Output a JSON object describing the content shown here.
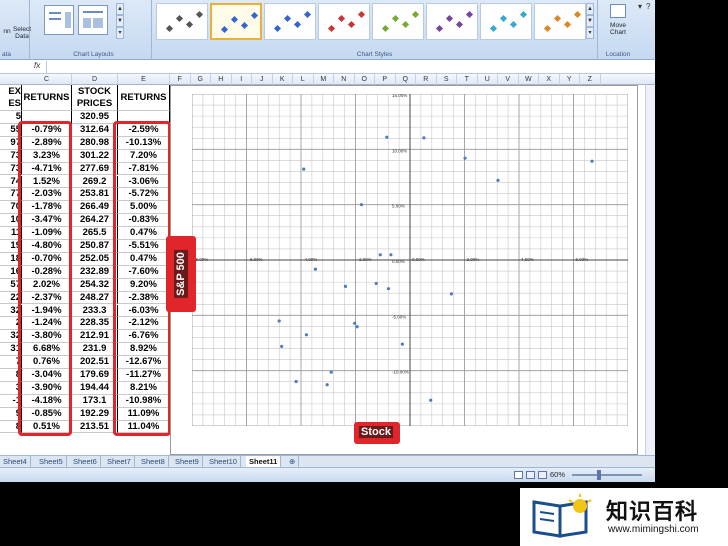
{
  "ribbon": {
    "left_group_partial": "ata",
    "small_btn_partial": "nn",
    "select_data": "Select Data",
    "chart_layouts_label": "Chart Layouts",
    "chart_styles_label": "Chart Styles",
    "move_chart": "Move Chart",
    "location_label": "Location",
    "style_colors": [
      "#555555",
      "#3366cc",
      "#3366cc",
      "#cc3333",
      "#77aa33",
      "#774499",
      "#33aacc",
      "#dd8822"
    ]
  },
  "formula_bar": {
    "fx_label": "fx"
  },
  "columns": [
    "C",
    "D",
    "E",
    "F",
    "G",
    "H",
    "I",
    "J",
    "K",
    "L",
    "M",
    "N",
    "O",
    "P",
    "Q",
    "R",
    "S",
    "T",
    "U",
    "V",
    "W",
    "X",
    "Y",
    "Z"
  ],
  "table": {
    "headers": {
      "b_line1": "EX",
      "b_line2": "ES",
      "c": "RETURNS",
      "d_line1": "STOCK",
      "d_line2": "PRICES",
      "e": "RETURNS"
    },
    "first_row": {
      "b": "5",
      "d": "320.95"
    },
    "rows": [
      {
        "b": "55",
        "c": "-0.79%",
        "d": "312.64",
        "e": "-2.59%"
      },
      {
        "b": "97",
        "c": "-2.89%",
        "d": "280.98",
        "e": "-10.13%"
      },
      {
        "b": "73",
        "c": "3.23%",
        "d": "301.22",
        "e": "7.20%"
      },
      {
        "b": "73",
        "c": "-4.71%",
        "d": "277.69",
        "e": "-7.81%"
      },
      {
        "b": "74",
        "c": "1.52%",
        "d": "269.2",
        "e": "-3.06%"
      },
      {
        "b": "77",
        "c": "-2.03%",
        "d": "253.81",
        "e": "-5.72%"
      },
      {
        "b": "70",
        "c": "-1.78%",
        "d": "266.49",
        "e": "5.00%"
      },
      {
        "b": "10",
        "c": "-3.47%",
        "d": "264.27",
        "e": "-0.83%"
      },
      {
        "b": "11",
        "c": "-1.09%",
        "d": "265.5",
        "e": "0.47%"
      },
      {
        "b": "19",
        "c": "-4.80%",
        "d": "250.87",
        "e": "-5.51%"
      },
      {
        "b": "18",
        "c": "-0.70%",
        "d": "252.05",
        "e": "0.47%"
      },
      {
        "b": "16",
        "c": "-0.28%",
        "d": "232.89",
        "e": "-7.60%"
      },
      {
        "b": "57",
        "c": "2.02%",
        "d": "254.32",
        "e": "9.20%"
      },
      {
        "b": "22",
        "c": "-2.37%",
        "d": "248.27",
        "e": "-2.38%"
      },
      {
        "b": "32",
        "c": "-1.94%",
        "d": "233.3",
        "e": "-6.03%"
      },
      {
        "b": "2",
        "c": "-1.24%",
        "d": "228.35",
        "e": "-2.12%"
      },
      {
        "b": "32",
        "c": "-3.80%",
        "d": "212.91",
        "e": "-6.76%"
      },
      {
        "b": "31",
        "c": "6.68%",
        "d": "231.9",
        "e": "8.92%"
      },
      {
        "b": "7",
        "c": "0.76%",
        "d": "202.51",
        "e": "-12.67%"
      },
      {
        "b": "8",
        "c": "-3.04%",
        "d": "179.69",
        "e": "-11.27%"
      },
      {
        "b": "3",
        "c": "-3.90%",
        "d": "194.44",
        "e": "8.21%"
      },
      {
        "b": "-1",
        "c": "-4.18%",
        "d": "173.1",
        "e": "-10.98%"
      },
      {
        "b": "9",
        "c": "-0.85%",
        "d": "192.29",
        "e": "11.09%"
      },
      {
        "b": "8",
        "c": "0.51%",
        "d": "213.51",
        "e": "11.04%"
      }
    ]
  },
  "callouts": {
    "sp500": "S&P 500",
    "stock": "Stock"
  },
  "chart_data": {
    "type": "scatter",
    "x_ticks": [
      "-8.00%",
      "-6.00%",
      "-4.00%",
      "-2.00%",
      "0.00%",
      "2.00%",
      "4.00%",
      "6.00%",
      "8.00%"
    ],
    "y_ticks": [
      "15.00%",
      "10.00%",
      "5.00%",
      "0.00%",
      "-5.00%",
      "-10.00%",
      "-15.00%"
    ],
    "xlim": [
      -8,
      8
    ],
    "ylim": [
      -15,
      15
    ],
    "grid": true,
    "point_color": "#4a7ebb",
    "points": [
      {
        "x": -0.79,
        "y": -2.59
      },
      {
        "x": -2.89,
        "y": -10.13
      },
      {
        "x": 3.23,
        "y": 7.2
      },
      {
        "x": -4.71,
        "y": -7.81
      },
      {
        "x": 1.52,
        "y": -3.06
      },
      {
        "x": -2.03,
        "y": -5.72
      },
      {
        "x": -1.78,
        "y": 5.0
      },
      {
        "x": -3.47,
        "y": -0.83
      },
      {
        "x": -1.09,
        "y": 0.47
      },
      {
        "x": -4.8,
        "y": -5.51
      },
      {
        "x": -0.7,
        "y": 0.47
      },
      {
        "x": -0.28,
        "y": -7.6
      },
      {
        "x": 2.02,
        "y": 9.2
      },
      {
        "x": -2.37,
        "y": -2.38
      },
      {
        "x": -1.94,
        "y": -6.03
      },
      {
        "x": -1.24,
        "y": -2.12
      },
      {
        "x": -3.8,
        "y": -6.76
      },
      {
        "x": 6.68,
        "y": 8.92
      },
      {
        "x": 0.76,
        "y": -12.67
      },
      {
        "x": -3.04,
        "y": -11.27
      },
      {
        "x": -3.9,
        "y": 8.21
      },
      {
        "x": -4.18,
        "y": -10.98
      },
      {
        "x": -0.85,
        "y": 11.09
      },
      {
        "x": 0.51,
        "y": 11.04
      }
    ]
  },
  "sheet_tabs": [
    "Sheet4",
    "Sheet5",
    "Sheet6",
    "Sheet7",
    "Sheet8",
    "Sheet9",
    "Sheet10",
    "Sheet11"
  ],
  "active_tab": "Sheet11",
  "status": {
    "zoom": "60%"
  },
  "logo": {
    "text": "知识百科",
    "url": "www.mimingshi.com"
  }
}
